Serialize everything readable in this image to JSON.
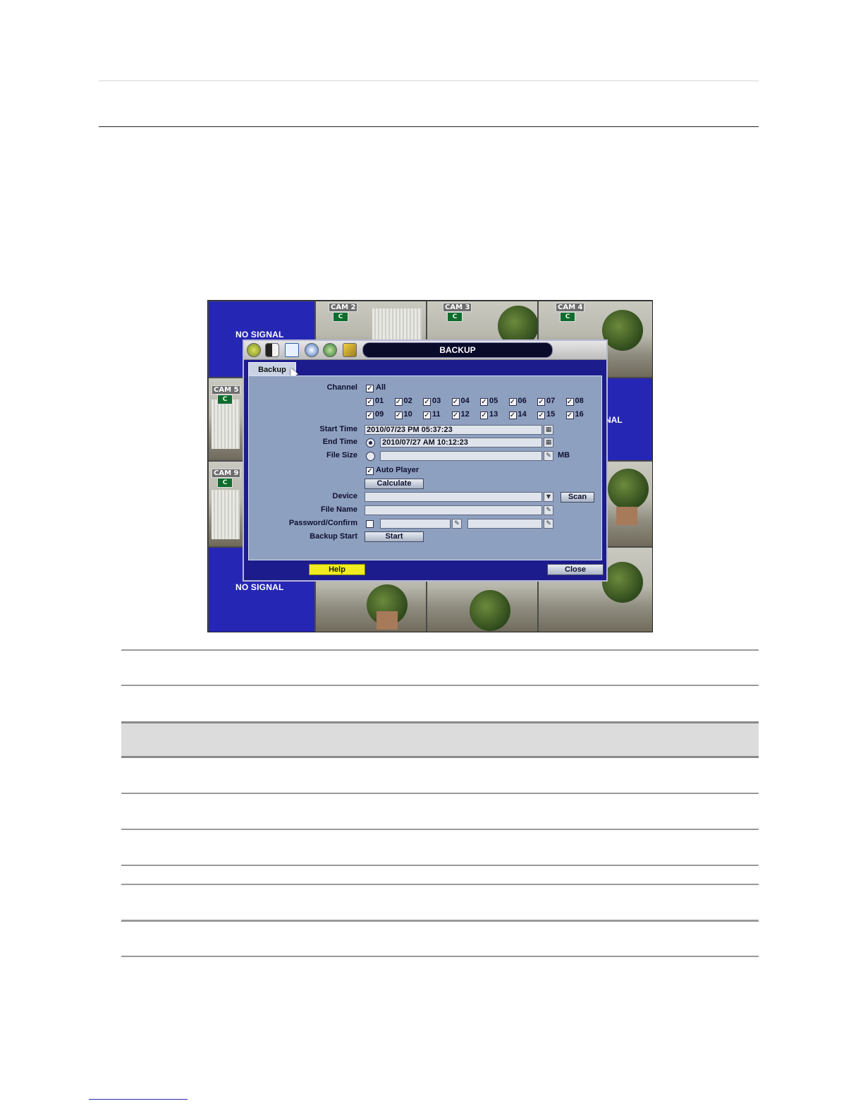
{
  "screen": {
    "cams": {
      "cam2": "CAM 2",
      "cam3": "CAM 3",
      "cam4": "CAM 4",
      "cam5": "CAM 5",
      "cam9": "CAM 9",
      "cam_icon": "C"
    },
    "no_signal_top": "NO SIGNAL",
    "no_signal_bottom": "NO SIGNAL",
    "right_edge_fragment": "NAL"
  },
  "dialog": {
    "title": "BACKUP",
    "tab": "Backup",
    "labels": {
      "channel": "Channel",
      "start_time": "Start Time",
      "end_time": "End Time",
      "file_size": "File Size",
      "device": "Device",
      "file_name": "File Name",
      "password": "Password/Confirm",
      "backup_start": "Backup Start"
    },
    "channel_all": "All",
    "channels_row1": [
      "01",
      "02",
      "03",
      "04",
      "05",
      "06",
      "07",
      "08"
    ],
    "channels_row2": [
      "09",
      "10",
      "11",
      "12",
      "13",
      "14",
      "15",
      "16"
    ],
    "start_time_value": "2010/07/23 PM 05:37:23",
    "end_time_value": "2010/07/27 AM 10:12:23",
    "file_size_value": "",
    "file_size_unit": "MB",
    "auto_player": "Auto Player",
    "calculate": "Calculate",
    "device_value": "",
    "scan": "Scan",
    "file_name_value": "",
    "start": "Start",
    "help": "Help",
    "close": "Close"
  }
}
